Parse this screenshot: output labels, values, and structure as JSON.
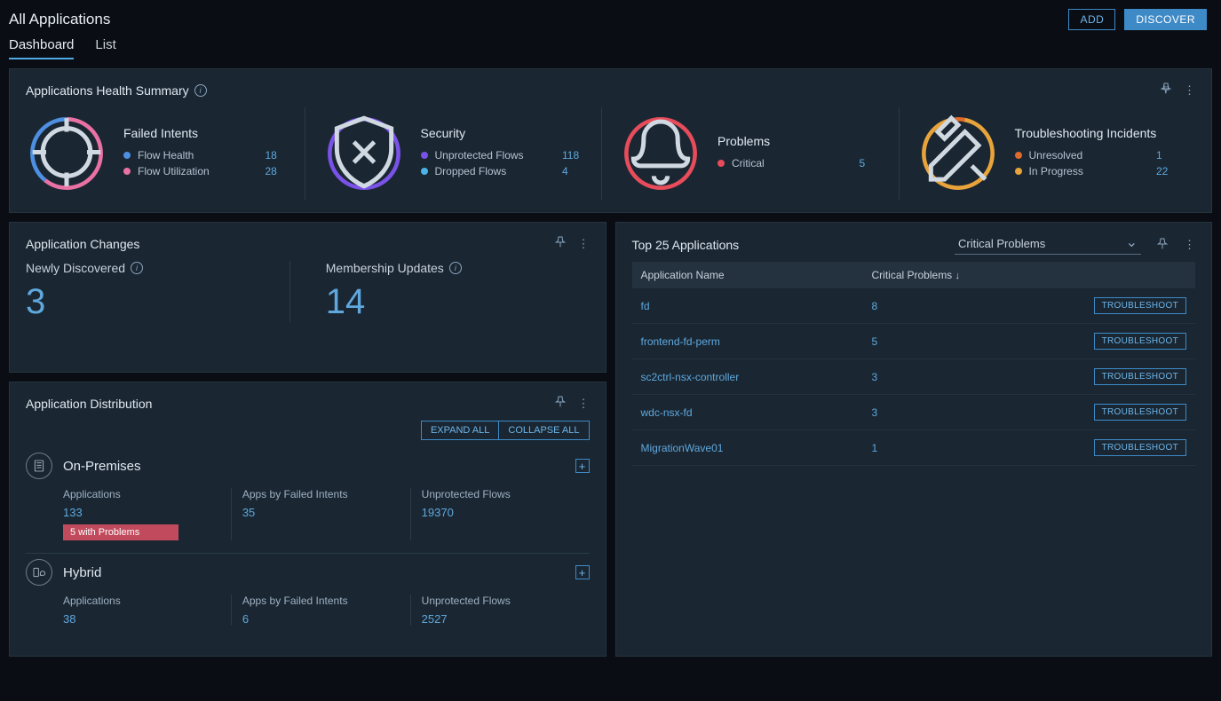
{
  "header": {
    "title": "All Applications",
    "add_label": "ADD",
    "discover_label": "DISCOVER"
  },
  "tabs": [
    {
      "label": "Dashboard",
      "active": true
    },
    {
      "label": "List",
      "active": false
    }
  ],
  "health_summary": {
    "title": "Applications Health Summary",
    "items": [
      {
        "heading": "Failed Intents",
        "legend": [
          {
            "color": "#4e8fe2",
            "label": "Flow Health",
            "value": "18"
          },
          {
            "color": "#e971a3",
            "label": "Flow Utilization",
            "value": "28"
          }
        ]
      },
      {
        "heading": "Security",
        "legend": [
          {
            "color": "#7a52e8",
            "label": "Unprotected Flows",
            "value": "118"
          },
          {
            "color": "#4cb3e8",
            "label": "Dropped Flows",
            "value": "4"
          }
        ]
      },
      {
        "heading": "Problems",
        "legend": [
          {
            "color": "#e84c5a",
            "label": "Critical",
            "value": "5"
          }
        ]
      },
      {
        "heading": "Troubleshooting Incidents",
        "legend": [
          {
            "color": "#e06a2b",
            "label": "Unresolved",
            "value": "1"
          },
          {
            "color": "#e8a43a",
            "label": "In Progress",
            "value": "22"
          }
        ]
      }
    ]
  },
  "changes": {
    "title": "Application Changes",
    "newly_discovered": {
      "label": "Newly Discovered",
      "value": "3"
    },
    "membership_updates": {
      "label": "Membership Updates",
      "value": "14"
    }
  },
  "distribution": {
    "title": "Application Distribution",
    "expand_all": "EXPAND ALL",
    "collapse_all": "COLLAPSE ALL",
    "groups": [
      {
        "name": "On-Premises",
        "cols": [
          {
            "label": "Applications",
            "value": "133",
            "badge": "5 with Problems"
          },
          {
            "label": "Apps by Failed Intents",
            "value": "35"
          },
          {
            "label": "Unprotected Flows",
            "value": "19370"
          }
        ]
      },
      {
        "name": "Hybrid",
        "cols": [
          {
            "label": "Applications",
            "value": "38"
          },
          {
            "label": "Apps by Failed Intents",
            "value": "6"
          },
          {
            "label": "Unprotected Flows",
            "value": "2527"
          }
        ]
      }
    ]
  },
  "top_apps": {
    "title": "Top 25 Applications",
    "filter_selected": "Critical Problems",
    "columns": {
      "name": "Application Name",
      "problems": "Critical Problems"
    },
    "troubleshoot_label": "TROUBLESHOOT",
    "rows": [
      {
        "name": "fd",
        "problems": "8"
      },
      {
        "name": "frontend-fd-perm",
        "problems": "5"
      },
      {
        "name": "sc2ctrl-nsx-controller",
        "problems": "3"
      },
      {
        "name": "wdc-nsx-fd",
        "problems": "3"
      },
      {
        "name": "MigrationWave01",
        "problems": "1"
      }
    ]
  }
}
